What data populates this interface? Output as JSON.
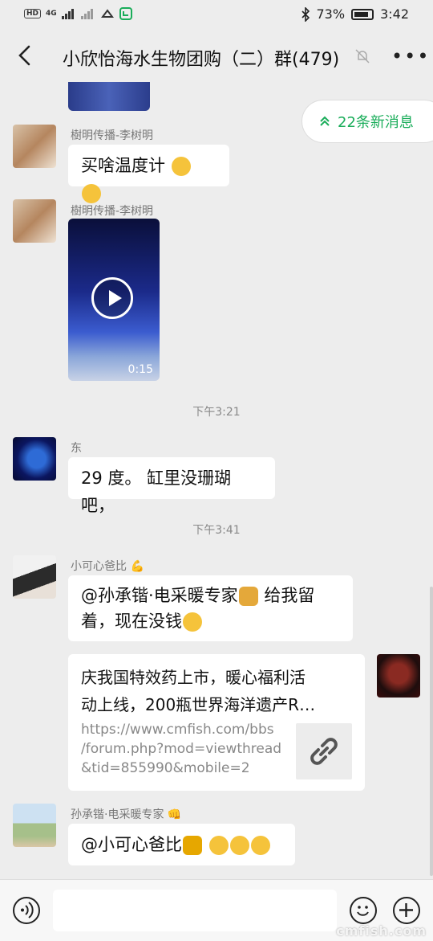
{
  "status_bar": {
    "left_icons": [
      "HD",
      "4G",
      "signal-icon",
      "wifi-icon",
      "alarm-icon",
      "app-icon"
    ],
    "battery": "73%",
    "time": "3:42"
  },
  "header": {
    "title": "小欣怡海水生物团购（二）群(479)"
  },
  "new_messages": "22条新消息",
  "messages": [
    {
      "sender": "樹明传播-李树明",
      "text": "买啥温度计"
    },
    {
      "sender": "樹明传播-李树明",
      "video_duration": "0:15"
    },
    {
      "time": "下午3:21"
    },
    {
      "sender": "东",
      "text": "29 度。 缸里没珊瑚吧，"
    },
    {
      "time": "下午3:41"
    },
    {
      "sender": "小可心爸比",
      "text_line1": "@孙承锴·电采暖专家",
      "text_line1b": " 给我留",
      "text_line2": "着，现在没钱"
    },
    {
      "link_title_line1": "庆我国特效药上市，暖心福利活",
      "link_title_line2": "动上线，200瓶世界海洋遗产R…",
      "link_url_line1": "https://www.cmfish.com/bbs",
      "link_url_line2": "/forum.php?mod=viewthread",
      "link_url_line3": "&tid=855990&mobile=2"
    },
    {
      "sender": "孙承锴·电采暖专家",
      "text": "@小可心爸比"
    }
  ],
  "watermark": "cmfish.com",
  "colors": {
    "accent": "#1aad5a",
    "background": "#ededed"
  }
}
